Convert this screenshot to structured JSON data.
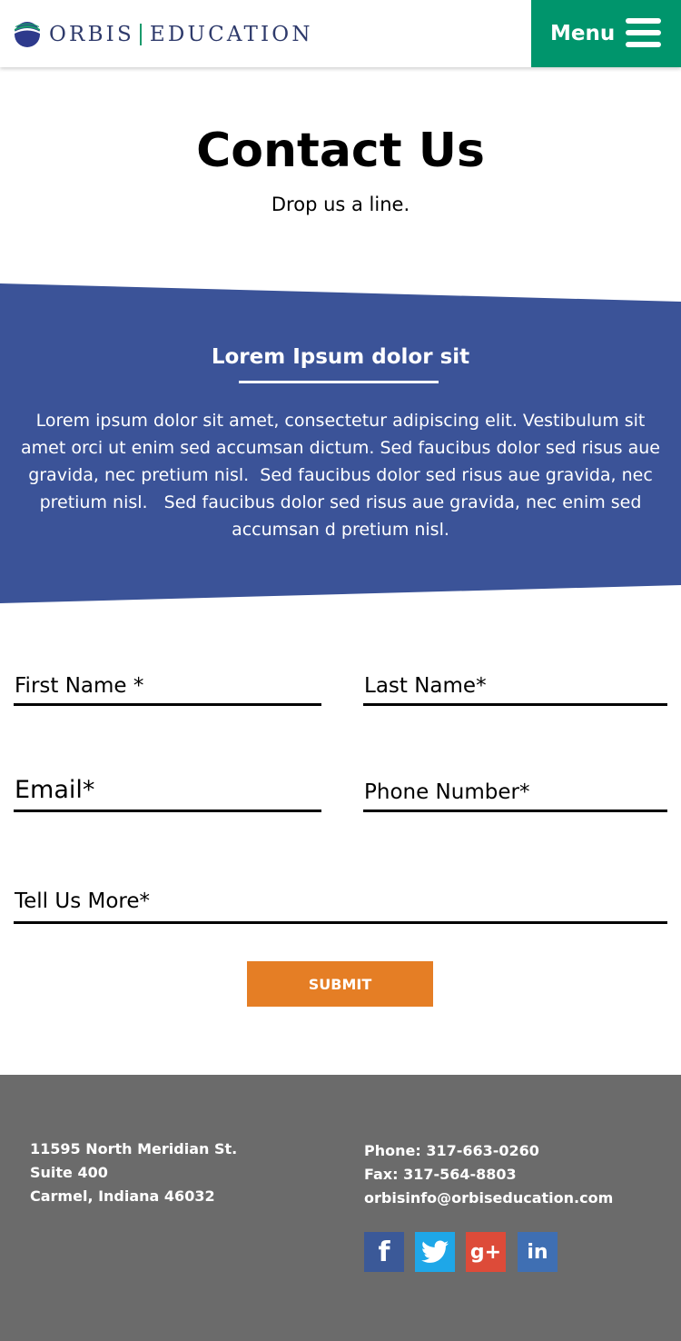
{
  "header": {
    "brand_left": "ORBIS",
    "brand_right": "EDUCATION",
    "menu_label": "Menu",
    "menu_color": "#00956c"
  },
  "hero": {
    "title": "Contact Us",
    "subtitle": "Drop us a line."
  },
  "band": {
    "heading": "Lorem Ipsum dolor sit",
    "text": "Lorem ipsum dolor sit amet, consectetur adipiscing elit. Vestibulum sit amet orci ut enim sed accumsan dictum. Sed faucibus dolor sed risus aue gravida, nec pretium nisl.  Sed faucibus dolor sed risus aue gravida, nec pretium nisl.   Sed faucibus dolor sed risus aue gravida, nec enim sed accumsan d pretium nisl.",
    "color": "#3b5398"
  },
  "form": {
    "first_name_placeholder": "First Name *",
    "last_name_placeholder": "Last Name*",
    "email_placeholder": "Email*",
    "phone_placeholder": "Phone Number*",
    "more_placeholder": "Tell Us More*",
    "submit_label": "SUBMIT",
    "submit_color": "#e57e25"
  },
  "footer": {
    "address_line1": "11595 North Meridian St.",
    "address_line2": "Suite 400",
    "address_line3": "Carmel, Indiana 46032",
    "phone": "Phone: 317-663-0260",
    "fax": "Fax: 317-564-8803",
    "email": "orbisinfo@orbiseducation.com",
    "social": [
      {
        "icon": "facebook-icon",
        "glyph": "f"
      },
      {
        "icon": "twitter-icon",
        "glyph": "🐦"
      },
      {
        "icon": "google-plus-icon",
        "glyph": "g+"
      },
      {
        "icon": "linkedin-icon",
        "glyph": "in"
      }
    ],
    "background": "#6b6b6b"
  }
}
